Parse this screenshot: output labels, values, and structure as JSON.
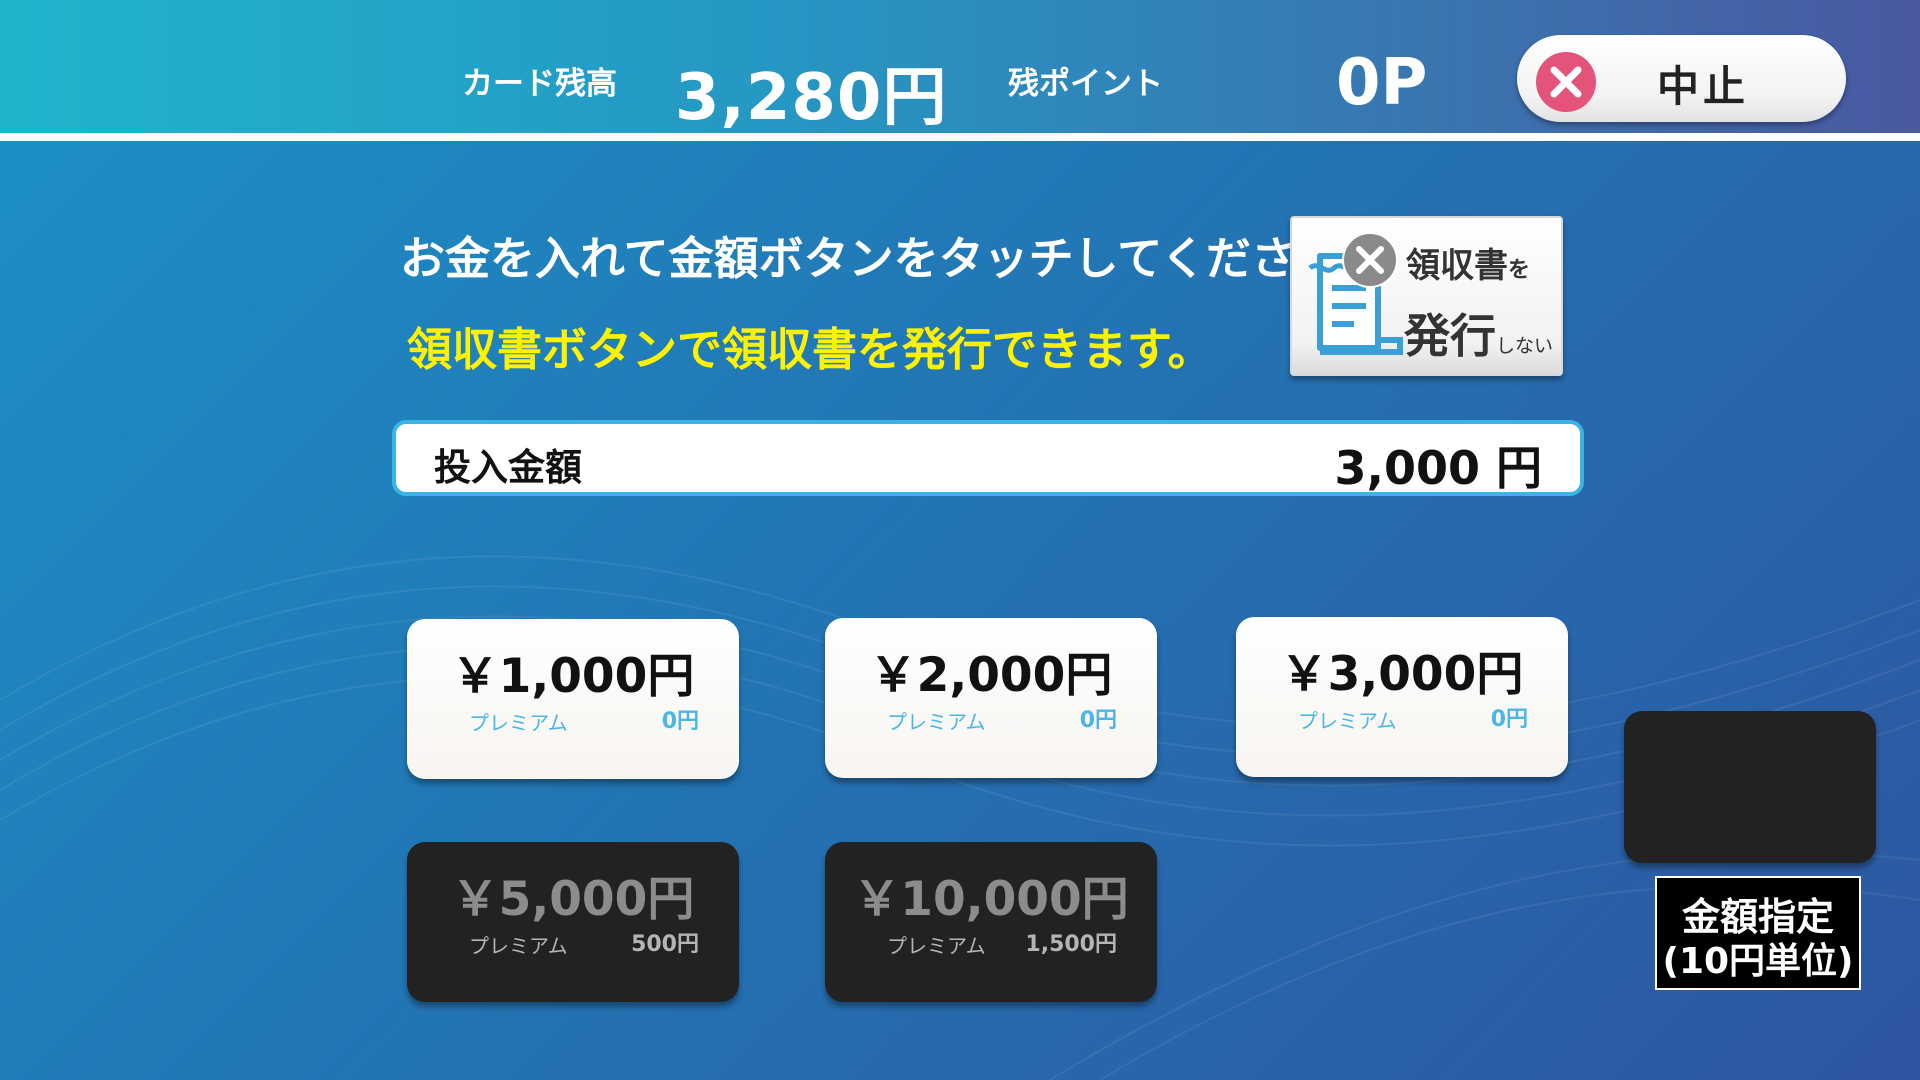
{
  "header": {
    "balance_label": "カード残高",
    "balance_value": "3,280円",
    "points_label": "残ポイント",
    "points_value": "0P",
    "cancel_label": "中止"
  },
  "instructions": {
    "line1": "お金を入れて金額ボタンをタッチしてください。",
    "line2": "領収書ボタンで領収書を発行できます。"
  },
  "receipt_button": {
    "line1_main": "領収書",
    "line1_small": "を",
    "line2_main": "発行",
    "line2_small": "しない",
    "icon": "receipt-icon"
  },
  "amount": {
    "label": "投入金額",
    "value": "3,000 円"
  },
  "denominations": [
    {
      "amount": "￥1,000円",
      "premium_label": "プレミアム",
      "bonus": "0円",
      "enabled": true
    },
    {
      "amount": "￥2,000円",
      "premium_label": "プレミアム",
      "bonus": "0円",
      "enabled": true
    },
    {
      "amount": "￥3,000円",
      "premium_label": "プレミアム",
      "bonus": "0円",
      "enabled": true
    },
    {
      "amount": "￥5,000円",
      "premium_label": "プレミアム",
      "bonus": "500円",
      "enabled": false
    },
    {
      "amount": "￥10,000円",
      "premium_label": "プレミアム",
      "bonus": "1,500円",
      "enabled": false
    }
  ],
  "specify_amount": {
    "line1": "金額指定",
    "line2": "(10円単位)"
  },
  "colors": {
    "accent_yellow": "#fff200",
    "bar_border": "#39b4e4",
    "cancel_red": "#e4547a",
    "premium_blue": "#4cb6e6"
  }
}
